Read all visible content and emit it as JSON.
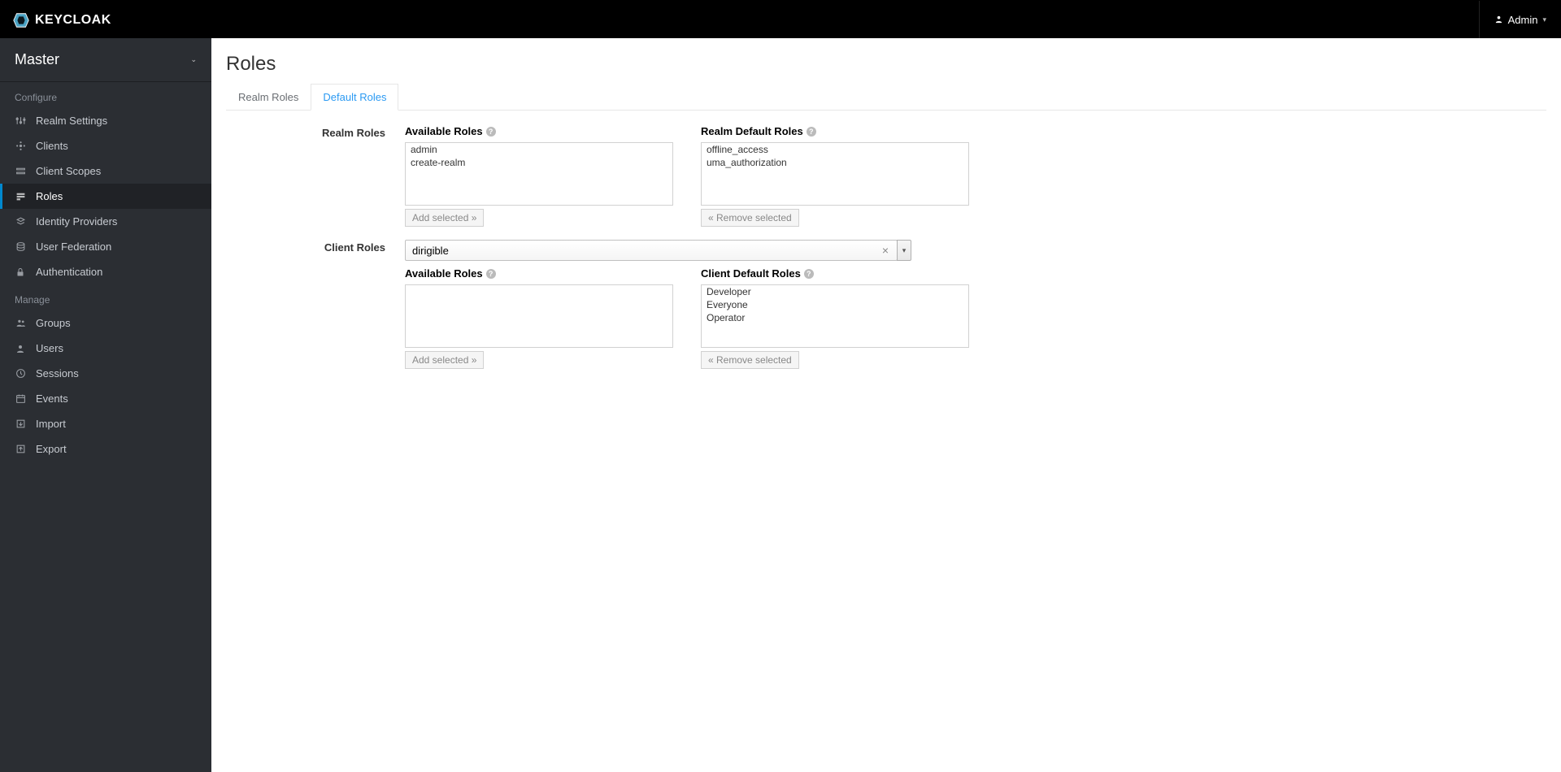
{
  "header": {
    "brand": "KEYCLOAK",
    "user": "Admin"
  },
  "sidebar": {
    "realm": "Master",
    "sections": [
      {
        "title": "Configure",
        "items": [
          {
            "label": "Realm Settings",
            "icon": "sliders"
          },
          {
            "label": "Clients",
            "icon": "clients"
          },
          {
            "label": "Client Scopes",
            "icon": "scopes"
          },
          {
            "label": "Roles",
            "icon": "roles",
            "active": true
          },
          {
            "label": "Identity Providers",
            "icon": "idp"
          },
          {
            "label": "User Federation",
            "icon": "fed"
          },
          {
            "label": "Authentication",
            "icon": "lock"
          }
        ]
      },
      {
        "title": "Manage",
        "items": [
          {
            "label": "Groups",
            "icon": "groups"
          },
          {
            "label": "Users",
            "icon": "user"
          },
          {
            "label": "Sessions",
            "icon": "clock"
          },
          {
            "label": "Events",
            "icon": "calendar"
          },
          {
            "label": "Import",
            "icon": "import"
          },
          {
            "label": "Export",
            "icon": "export"
          }
        ]
      }
    ]
  },
  "main": {
    "title": "Roles",
    "tabs": [
      {
        "label": "Realm Roles",
        "active": false
      },
      {
        "label": "Default Roles",
        "active": true
      }
    ],
    "realmRoles": {
      "label": "Realm Roles",
      "available": {
        "label": "Available Roles",
        "items": [
          "admin",
          "create-realm"
        ],
        "button": "Add selected »"
      },
      "default": {
        "label": "Realm Default Roles",
        "items": [
          "offline_access",
          "uma_authorization"
        ],
        "button": "« Remove selected"
      }
    },
    "clientRoles": {
      "label": "Client Roles",
      "selectedClient": "dirigible",
      "available": {
        "label": "Available Roles",
        "items": [],
        "button": "Add selected »"
      },
      "default": {
        "label": "Client Default Roles",
        "items": [
          "Developer",
          "Everyone",
          "Operator"
        ],
        "button": "« Remove selected"
      }
    }
  }
}
